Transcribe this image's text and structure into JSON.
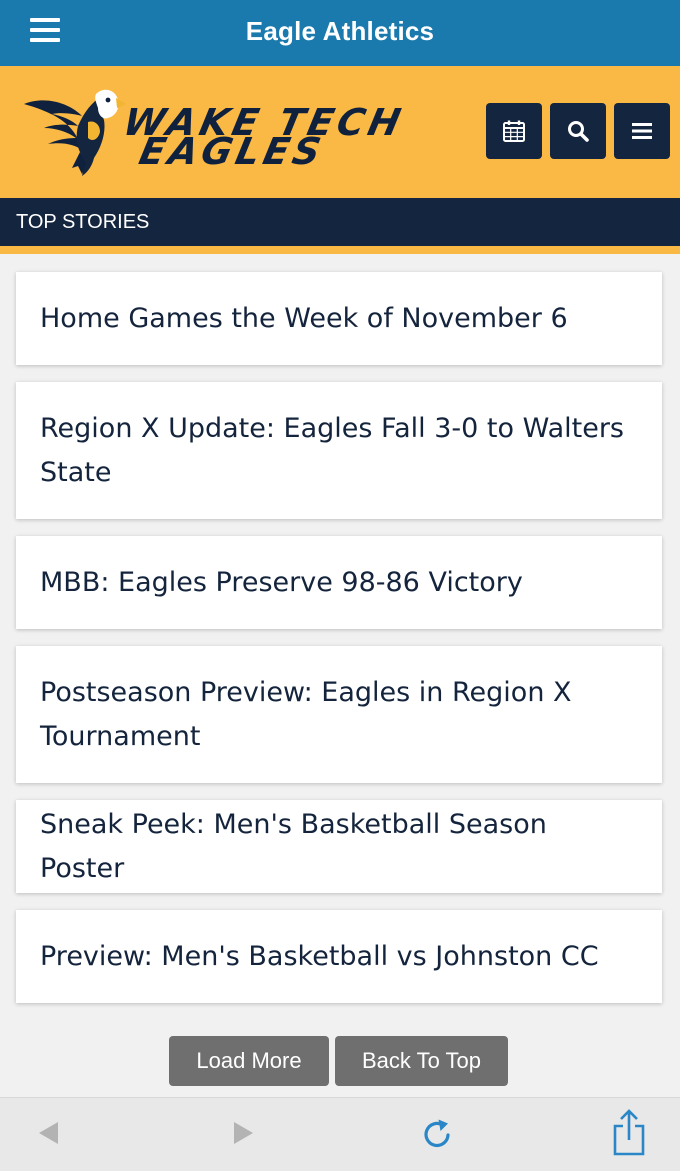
{
  "app_bar": {
    "title": "Eagle Athletics",
    "menu_icon": "hamburger-menu-icon"
  },
  "brand": {
    "logo_line1": "WAKE TECH",
    "logo_line2": "EAGLES",
    "colors": {
      "brand_gold": "#fab844",
      "navy": "#13253f",
      "app_bar_blue": "#1a79ad"
    },
    "icons": [
      "calendar-icon",
      "search-icon",
      "menu-icon"
    ]
  },
  "section": {
    "title": "TOP STORIES"
  },
  "stories": [
    {
      "title": "Home Games the Week of November 6"
    },
    {
      "title": "Region X Update: Eagles Fall 3-0 to Walters State"
    },
    {
      "title": "MBB: Eagles Preserve 98-86 Victory"
    },
    {
      "title": "Postseason Preview: Eagles in Region X Tournament"
    },
    {
      "title": "Sneak Peek: Men's Basketball Season Poster"
    },
    {
      "title": "Preview: Men's Basketball vs Johnston CC"
    }
  ],
  "actions": {
    "load_more": "Load More",
    "back_to_top": "Back To Top"
  },
  "toolbar": {
    "icons": [
      "back-arrow-icon",
      "forward-arrow-icon",
      "reload-icon",
      "share-icon"
    ]
  }
}
